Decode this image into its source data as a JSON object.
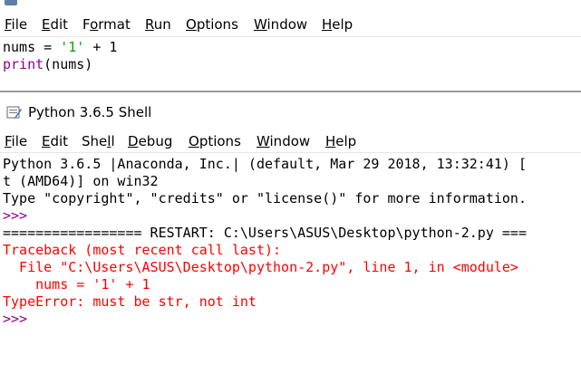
{
  "editor": {
    "menu": [
      {
        "u": "F",
        "rest": "ile"
      },
      {
        "u": "E",
        "rest": "dit"
      },
      {
        "pre": "F",
        "u": "o",
        "rest": "rmat"
      },
      {
        "u": "R",
        "rest": "un"
      },
      {
        "u": "O",
        "rest": "ptions"
      },
      {
        "u": "W",
        "rest": "indow"
      },
      {
        "u": "H",
        "rest": "elp"
      }
    ],
    "code": {
      "line1": {
        "a": "nums = ",
        "b": "'1'",
        "c": " + 1"
      },
      "line2": {
        "a": "print",
        "b": "(nums)"
      }
    }
  },
  "shell": {
    "title": "Python 3.6.5 Shell",
    "menu": [
      {
        "u": "F",
        "rest": "ile"
      },
      {
        "u": "E",
        "rest": "dit"
      },
      {
        "pre": "She",
        "u": "l",
        "rest": "l"
      },
      {
        "u": "D",
        "rest": "ebug"
      },
      {
        "u": "O",
        "rest": "ptions"
      },
      {
        "u": "W",
        "rest": "indow"
      },
      {
        "u": "H",
        "rest": "elp"
      }
    ],
    "lines": {
      "banner1": "Python 3.6.5 |Anaconda, Inc.| (default, Mar 29 2018, 13:32:41) [",
      "banner2": "t (AMD64)] on win32",
      "banner3": "Type \"copyright\", \"credits\" or \"license()\" for more information.",
      "prompt1": ">>>",
      "restart": "================= RESTART: C:\\Users\\ASUS\\Desktop\\python-2.py ===",
      "tb1": "Traceback (most recent call last):",
      "tb2": "  File \"C:\\Users\\ASUS\\Desktop\\python-2.py\", line 1, in <module>",
      "tb3": "    nums = '1' + 1",
      "tb4": "TypeError: must be str, not int",
      "prompt2": ">>>"
    }
  },
  "colors": {
    "text": "#000000",
    "string": "#00aa00",
    "builtin": "#900090",
    "error": "#ff0000",
    "prompt": "#900090"
  }
}
